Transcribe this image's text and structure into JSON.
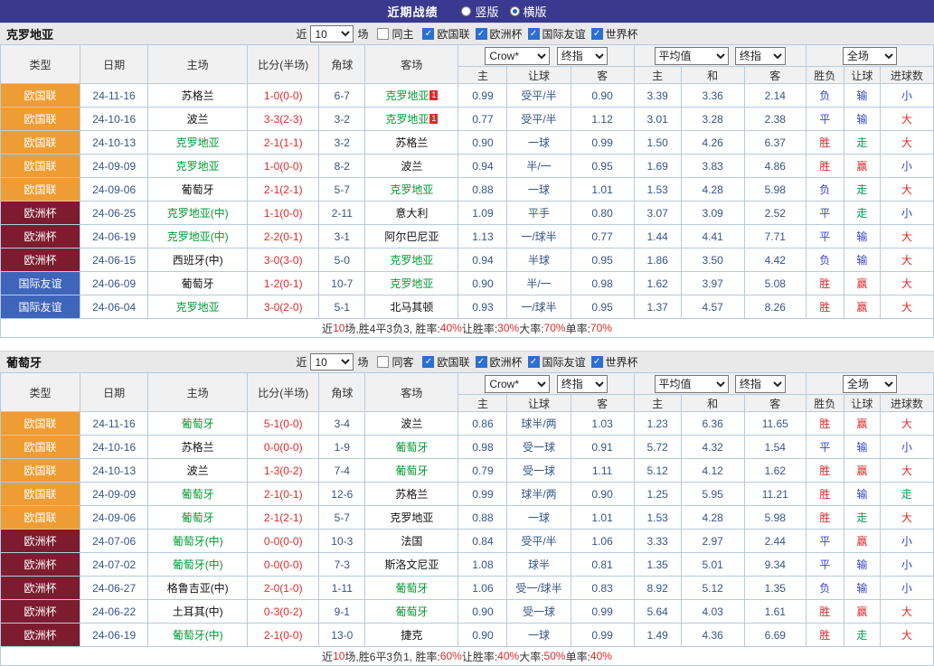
{
  "titlebar": {
    "title": "近期战绩",
    "radios": [
      {
        "label": "竖版",
        "selected": false
      },
      {
        "label": "横版",
        "selected": true
      }
    ]
  },
  "filter": {
    "near": "近",
    "games": "场",
    "comps": [
      "欧国联",
      "欧洲杯",
      "国际友谊",
      "世界杯"
    ]
  },
  "table_header": {
    "static_cols": [
      "类型",
      "日期",
      "主场",
      "比分(半场)",
      "角球",
      "客场"
    ],
    "odds_dd1": "Crow*",
    "odds_dd2": "终指",
    "avg_dd1": "平均值",
    "avg_dd2": "终指",
    "scope_dd": "全场",
    "sub_cols": [
      "主",
      "让球",
      "客",
      "主",
      "和",
      "客",
      "胜负",
      "让球",
      "进球数"
    ]
  },
  "type_colors": {
    "欧国联": "#ee9d35",
    "欧洲杯": "#7d1c2f",
    "国际友谊": "#3f65ba"
  },
  "result_colors": {
    "r": "#e02a2a",
    "b": "#3344cc",
    "g": "#00a050"
  },
  "sections": [
    {
      "team": "克罗地亚",
      "count": "10",
      "same_label": "同主",
      "same_checked": false,
      "comps_checked": [
        true,
        true,
        true,
        true
      ],
      "rows": [
        {
          "type": "欧国联",
          "date": "24-11-16",
          "home": "苏格兰",
          "hf": false,
          "hbadge": "",
          "score": "1-0(0-0)",
          "corner": "6-7",
          "away": "克罗地亚",
          "af": true,
          "abadge": "1",
          "odds": [
            "0.99",
            "受平/半",
            "0.90"
          ],
          "avg": [
            "3.39",
            "3.36",
            "2.14"
          ],
          "res": [
            [
              "负",
              "b"
            ],
            [
              "输",
              "b"
            ],
            [
              "小",
              "b"
            ]
          ]
        },
        {
          "type": "欧国联",
          "date": "24-10-16",
          "home": "波兰",
          "hf": false,
          "hbadge": "",
          "score": "3-3(2-3)",
          "corner": "3-2",
          "away": "克罗地亚",
          "af": true,
          "abadge": "1",
          "odds": [
            "0.77",
            "受平/半",
            "1.12"
          ],
          "avg": [
            "3.01",
            "3.28",
            "2.38"
          ],
          "res": [
            [
              "平",
              "b"
            ],
            [
              "输",
              "b"
            ],
            [
              "大",
              "r"
            ]
          ]
        },
        {
          "type": "欧国联",
          "date": "24-10-13",
          "home": "克罗地亚",
          "hf": true,
          "hbadge": "",
          "score": "2-1(1-1)",
          "corner": "3-2",
          "away": "苏格兰",
          "af": false,
          "abadge": "",
          "odds": [
            "0.90",
            "一球",
            "0.99"
          ],
          "avg": [
            "1.50",
            "4.26",
            "6.37"
          ],
          "res": [
            [
              "胜",
              "r"
            ],
            [
              "走",
              "g"
            ],
            [
              "大",
              "r"
            ]
          ]
        },
        {
          "type": "欧国联",
          "date": "24-09-09",
          "home": "克罗地亚",
          "hf": true,
          "hbadge": "",
          "score": "1-0(0-0)",
          "corner": "8-2",
          "away": "波兰",
          "af": false,
          "abadge": "",
          "odds": [
            "0.94",
            "半/一",
            "0.95"
          ],
          "avg": [
            "1.69",
            "3.83",
            "4.86"
          ],
          "res": [
            [
              "胜",
              "r"
            ],
            [
              "赢",
              "r"
            ],
            [
              "小",
              "b"
            ]
          ]
        },
        {
          "type": "欧国联",
          "date": "24-09-06",
          "home": "葡萄牙",
          "hf": false,
          "hbadge": "",
          "score": "2-1(2-1)",
          "corner": "5-7",
          "away": "克罗地亚",
          "af": true,
          "abadge": "",
          "odds": [
            "0.88",
            "一球",
            "1.01"
          ],
          "avg": [
            "1.53",
            "4.28",
            "5.98"
          ],
          "res": [
            [
              "负",
              "b"
            ],
            [
              "走",
              "g"
            ],
            [
              "大",
              "r"
            ]
          ]
        },
        {
          "type": "欧洲杯",
          "date": "24-06-25",
          "home": "克罗地亚(中)",
          "hf": true,
          "hbadge": "",
          "score": "1-1(0-0)",
          "corner": "2-11",
          "away": "意大利",
          "af": false,
          "abadge": "",
          "odds": [
            "1.09",
            "平手",
            "0.80"
          ],
          "avg": [
            "3.07",
            "3.09",
            "2.52"
          ],
          "res": [
            [
              "平",
              "b"
            ],
            [
              "走",
              "g"
            ],
            [
              "小",
              "b"
            ]
          ]
        },
        {
          "type": "欧洲杯",
          "date": "24-06-19",
          "home": "克罗地亚(中)",
          "hf": true,
          "hbadge": "",
          "score": "2-2(0-1)",
          "corner": "3-1",
          "away": "阿尔巴尼亚",
          "af": false,
          "abadge": "",
          "odds": [
            "1.13",
            "一/球半",
            "0.77"
          ],
          "avg": [
            "1.44",
            "4.41",
            "7.71"
          ],
          "res": [
            [
              "平",
              "b"
            ],
            [
              "输",
              "b"
            ],
            [
              "大",
              "r"
            ]
          ]
        },
        {
          "type": "欧洲杯",
          "date": "24-06-15",
          "home": "西班牙(中)",
          "hf": false,
          "hbadge": "",
          "score": "3-0(3-0)",
          "corner": "5-0",
          "away": "克罗地亚",
          "af": true,
          "abadge": "",
          "odds": [
            "0.94",
            "半球",
            "0.95"
          ],
          "avg": [
            "1.86",
            "3.50",
            "4.42"
          ],
          "res": [
            [
              "负",
              "b"
            ],
            [
              "输",
              "b"
            ],
            [
              "大",
              "r"
            ]
          ]
        },
        {
          "type": "国际友谊",
          "date": "24-06-09",
          "home": "葡萄牙",
          "hf": false,
          "hbadge": "",
          "score": "1-2(0-1)",
          "corner": "10-7",
          "away": "克罗地亚",
          "af": true,
          "abadge": "",
          "odds": [
            "0.90",
            "半/一",
            "0.98"
          ],
          "avg": [
            "1.62",
            "3.97",
            "5.08"
          ],
          "res": [
            [
              "胜",
              "r"
            ],
            [
              "赢",
              "r"
            ],
            [
              "大",
              "r"
            ]
          ]
        },
        {
          "type": "国际友谊",
          "date": "24-06-04",
          "home": "克罗地亚",
          "hf": true,
          "hbadge": "",
          "score": "3-0(2-0)",
          "corner": "5-1",
          "away": "北马其顿",
          "af": false,
          "abadge": "",
          "odds": [
            "0.93",
            "一/球半",
            "0.95"
          ],
          "avg": [
            "1.37",
            "4.57",
            "8.26"
          ],
          "res": [
            [
              "胜",
              "r"
            ],
            [
              "赢",
              "r"
            ],
            [
              "大",
              "r"
            ]
          ]
        }
      ],
      "summary": [
        [
          "近",
          "k"
        ],
        [
          "10",
          "r"
        ],
        [
          "场,胜4平3负3, 胜率:",
          "k"
        ],
        [
          "40%",
          "r"
        ],
        [
          " 让胜率:",
          "k"
        ],
        [
          "30%",
          "r"
        ],
        [
          " 大率:",
          "k"
        ],
        [
          "70%",
          "r"
        ],
        [
          " 单率:",
          "k"
        ],
        [
          "70%",
          "r"
        ]
      ]
    },
    {
      "team": "葡萄牙",
      "count": "10",
      "same_label": "同客",
      "same_checked": false,
      "comps_checked": [
        true,
        true,
        true,
        true
      ],
      "rows": [
        {
          "type": "欧国联",
          "date": "24-11-16",
          "home": "葡萄牙",
          "hf": true,
          "hbadge": "",
          "score": "5-1(0-0)",
          "corner": "3-4",
          "away": "波兰",
          "af": false,
          "abadge": "",
          "odds": [
            "0.86",
            "球半/两",
            "1.03"
          ],
          "avg": [
            "1.23",
            "6.36",
            "11.65"
          ],
          "res": [
            [
              "胜",
              "r"
            ],
            [
              "赢",
              "r"
            ],
            [
              "大",
              "r"
            ]
          ]
        },
        {
          "type": "欧国联",
          "date": "24-10-16",
          "home": "苏格兰",
          "hf": false,
          "hbadge": "",
          "score": "0-0(0-0)",
          "corner": "1-9",
          "away": "葡萄牙",
          "af": true,
          "abadge": "",
          "odds": [
            "0.98",
            "受一球",
            "0.91"
          ],
          "avg": [
            "5.72",
            "4.32",
            "1.54"
          ],
          "res": [
            [
              "平",
              "b"
            ],
            [
              "输",
              "b"
            ],
            [
              "小",
              "b"
            ]
          ]
        },
        {
          "type": "欧国联",
          "date": "24-10-13",
          "home": "波兰",
          "hf": false,
          "hbadge": "",
          "score": "1-3(0-2)",
          "corner": "7-4",
          "away": "葡萄牙",
          "af": true,
          "abadge": "",
          "odds": [
            "0.79",
            "受一球",
            "1.11"
          ],
          "avg": [
            "5.12",
            "4.12",
            "1.62"
          ],
          "res": [
            [
              "胜",
              "r"
            ],
            [
              "赢",
              "r"
            ],
            [
              "大",
              "r"
            ]
          ]
        },
        {
          "type": "欧国联",
          "date": "24-09-09",
          "home": "葡萄牙",
          "hf": true,
          "hbadge": "",
          "score": "2-1(0-1)",
          "corner": "12-6",
          "away": "苏格兰",
          "af": false,
          "abadge": "",
          "odds": [
            "0.99",
            "球半/两",
            "0.90"
          ],
          "avg": [
            "1.25",
            "5.95",
            "11.21"
          ],
          "res": [
            [
              "胜",
              "r"
            ],
            [
              "输",
              "b"
            ],
            [
              "走",
              "g"
            ]
          ]
        },
        {
          "type": "欧国联",
          "date": "24-09-06",
          "home": "葡萄牙",
          "hf": true,
          "hbadge": "",
          "score": "2-1(2-1)",
          "corner": "5-7",
          "away": "克罗地亚",
          "af": false,
          "abadge": "",
          "odds": [
            "0.88",
            "一球",
            "1.01"
          ],
          "avg": [
            "1.53",
            "4.28",
            "5.98"
          ],
          "res": [
            [
              "胜",
              "r"
            ],
            [
              "走",
              "g"
            ],
            [
              "大",
              "r"
            ]
          ]
        },
        {
          "type": "欧洲杯",
          "date": "24-07-06",
          "home": "葡萄牙(中)",
          "hf": true,
          "hbadge": "",
          "score": "0-0(0-0)",
          "corner": "10-3",
          "away": "法国",
          "af": false,
          "abadge": "",
          "odds": [
            "0.84",
            "受平/半",
            "1.06"
          ],
          "avg": [
            "3.33",
            "2.97",
            "2.44"
          ],
          "res": [
            [
              "平",
              "b"
            ],
            [
              "赢",
              "r"
            ],
            [
              "小",
              "b"
            ]
          ]
        },
        {
          "type": "欧洲杯",
          "date": "24-07-02",
          "home": "葡萄牙(中)",
          "hf": true,
          "hbadge": "",
          "score": "0-0(0-0)",
          "corner": "7-3",
          "away": "斯洛文尼亚",
          "af": false,
          "abadge": "",
          "odds": [
            "1.08",
            "球半",
            "0.81"
          ],
          "avg": [
            "1.35",
            "5.01",
            "9.34"
          ],
          "res": [
            [
              "平",
              "b"
            ],
            [
              "输",
              "b"
            ],
            [
              "小",
              "b"
            ]
          ]
        },
        {
          "type": "欧洲杯",
          "date": "24-06-27",
          "home": "格鲁吉亚(中)",
          "hf": false,
          "hbadge": "",
          "score": "2-0(1-0)",
          "corner": "1-11",
          "away": "葡萄牙",
          "af": true,
          "abadge": "",
          "odds": [
            "1.06",
            "受一/球半",
            "0.83"
          ],
          "avg": [
            "8.92",
            "5.12",
            "1.35"
          ],
          "res": [
            [
              "负",
              "b"
            ],
            [
              "输",
              "b"
            ],
            [
              "小",
              "b"
            ]
          ]
        },
        {
          "type": "欧洲杯",
          "date": "24-06-22",
          "home": "土耳其(中)",
          "hf": false,
          "hbadge": "",
          "score": "0-3(0-2)",
          "corner": "9-1",
          "away": "葡萄牙",
          "af": true,
          "abadge": "",
          "odds": [
            "0.90",
            "受一球",
            "0.99"
          ],
          "avg": [
            "5.64",
            "4.03",
            "1.61"
          ],
          "res": [
            [
              "胜",
              "r"
            ],
            [
              "赢",
              "r"
            ],
            [
              "大",
              "r"
            ]
          ]
        },
        {
          "type": "欧洲杯",
          "date": "24-06-19",
          "home": "葡萄牙(中)",
          "hf": true,
          "hbadge": "",
          "score": "2-1(0-0)",
          "corner": "13-0",
          "away": "捷克",
          "af": false,
          "abadge": "",
          "odds": [
            "0.90",
            "一球",
            "0.99"
          ],
          "avg": [
            "1.49",
            "4.36",
            "6.69"
          ],
          "res": [
            [
              "胜",
              "r"
            ],
            [
              "走",
              "g"
            ],
            [
              "大",
              "r"
            ]
          ]
        }
      ],
      "summary": [
        [
          "近",
          "k"
        ],
        [
          "10",
          "r"
        ],
        [
          "场,胜6平3负1, 胜率:",
          "k"
        ],
        [
          "60%",
          "r"
        ],
        [
          " 让胜率:",
          "k"
        ],
        [
          "40%",
          "r"
        ],
        [
          " 大率:",
          "k"
        ],
        [
          "50%",
          "r"
        ],
        [
          " 单率:",
          "k"
        ],
        [
          "40%",
          "r"
        ]
      ]
    }
  ]
}
